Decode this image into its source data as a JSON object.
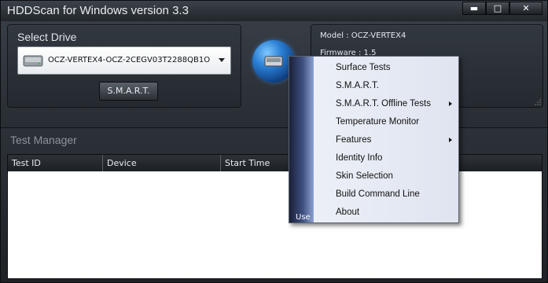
{
  "window": {
    "title": "HDDScan for Windows version 3.3",
    "buttons": {
      "minimize": "▬",
      "maximize": "□",
      "close": "✕"
    }
  },
  "drive": {
    "label": "Select Drive",
    "selected": "OCZ-VERTEX4-OCZ-2CEGV03T2288QB1O",
    "smart_button": "S.M.A.R.T."
  },
  "info": {
    "model": "Model : OCZ-VERTEX4",
    "firmware": "Firmware : 1.5"
  },
  "test_manager": {
    "title": "Test Manager",
    "columns": [
      "Test ID",
      "Device",
      "Start Time"
    ]
  },
  "menu": {
    "strip_text": "Use",
    "items": [
      {
        "label": "Surface Tests",
        "submenu": false
      },
      {
        "label": "S.M.A.R.T.",
        "submenu": false
      },
      {
        "label": "S.M.A.R.T. Offline Tests",
        "submenu": true
      },
      {
        "label": "Temperature Monitor",
        "submenu": false
      },
      {
        "label": "Features",
        "submenu": true
      },
      {
        "label": "Identity Info",
        "submenu": false
      },
      {
        "label": "Skin Selection",
        "submenu": false
      },
      {
        "label": "Build Command Line",
        "submenu": false
      },
      {
        "label": "About",
        "submenu": false
      }
    ]
  },
  "icons": {
    "drive": "hard-drive-icon",
    "globe": "globe-drive-icon",
    "dropdown": "chevron-down-icon",
    "submenu": "chevron-right-icon"
  },
  "colors": {
    "background": "#2a2f36",
    "menu_strip": "#3e4f80",
    "globe": "#2a7fd4"
  }
}
